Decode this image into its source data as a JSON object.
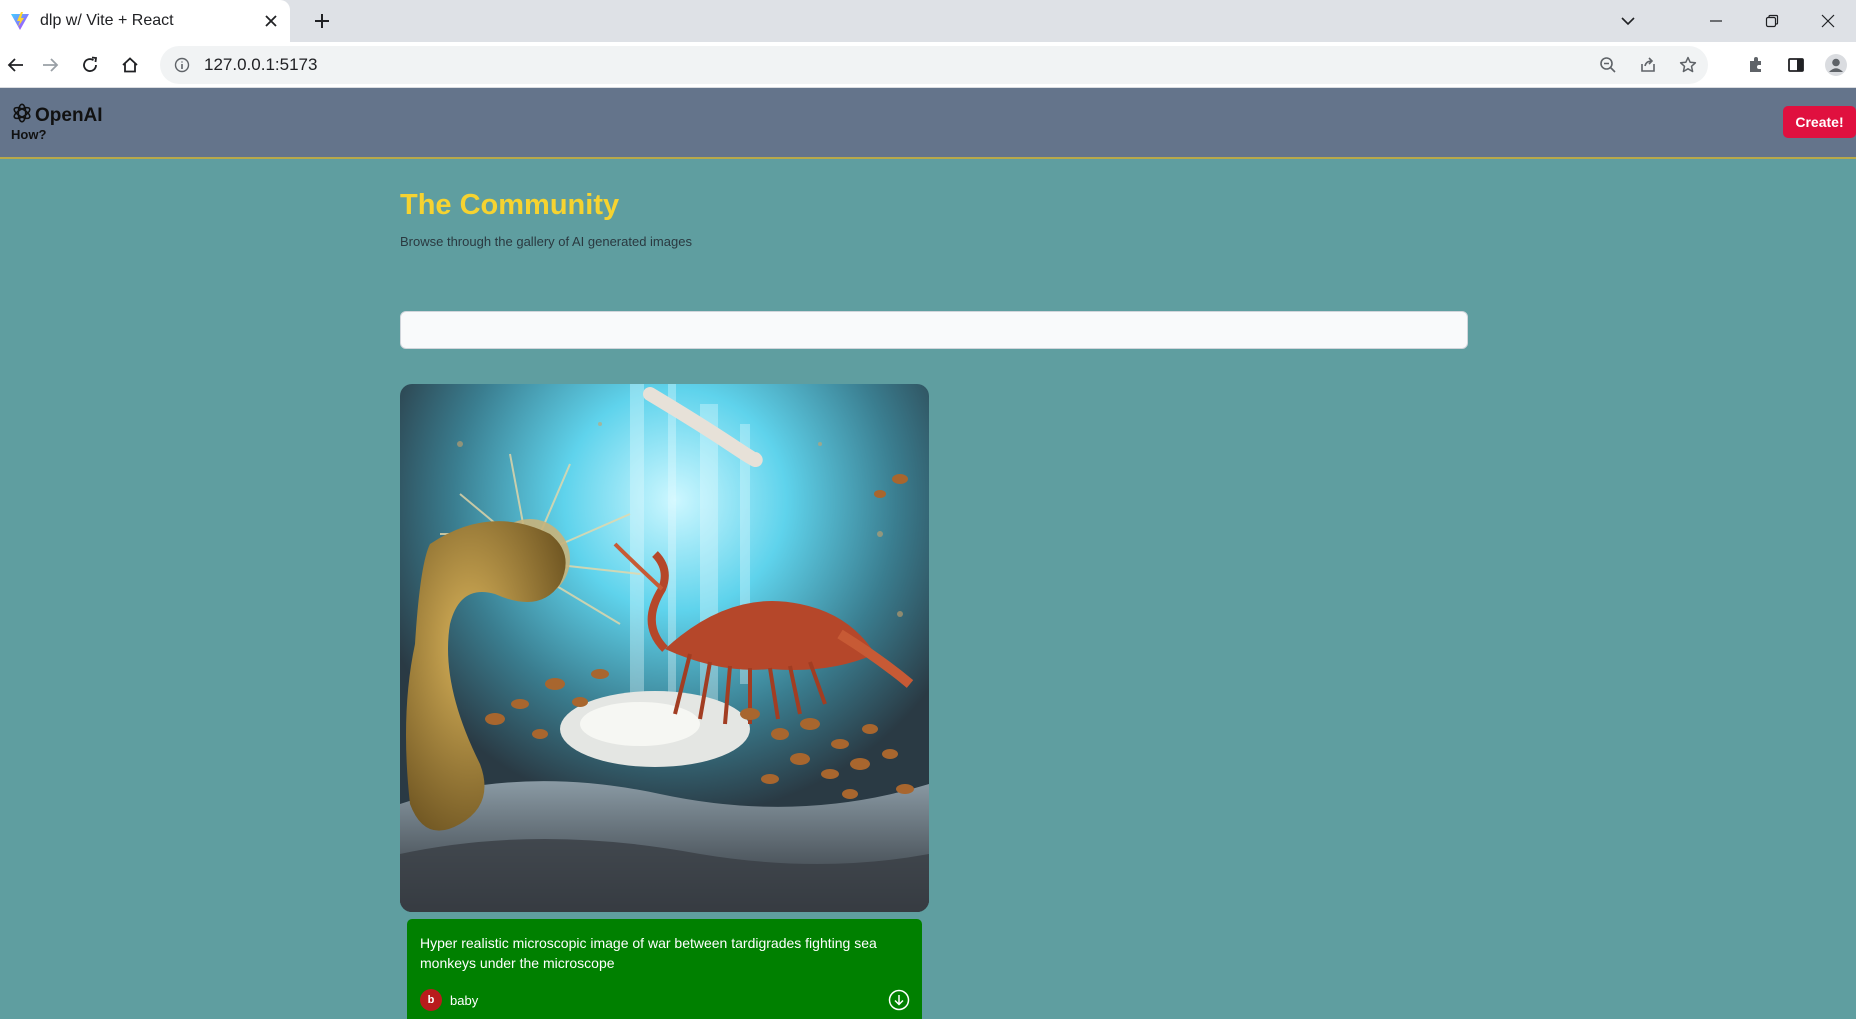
{
  "browser": {
    "tab_title": "dlp w/ Vite + React",
    "url": "127.0.0.1:5173"
  },
  "header": {
    "brand": "OpenAI",
    "how_link": "How?",
    "create_label": "Create!"
  },
  "main": {
    "title": "The Community",
    "subtitle": "Browse through the gallery of AI generated images",
    "search_value": ""
  },
  "posts": [
    {
      "prompt": "Hyper realistic microscopic image of war between tardigrades fighting sea monkeys under the microscope",
      "author_initial": "b",
      "author_name": "baby"
    }
  ],
  "colors": {
    "page_bg": "#5f9ea0",
    "header_bg": "#64748b",
    "title": "#f6d330",
    "create_button": "#e0103f",
    "card_info_bg": "#008000",
    "avatar": "#b91c1c"
  }
}
